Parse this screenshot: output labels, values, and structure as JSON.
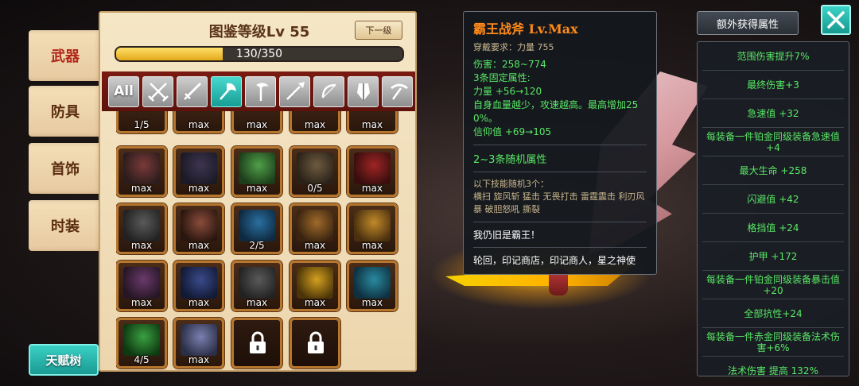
{
  "nav": {
    "tabs": [
      "武器",
      "防具",
      "首饰",
      "时装"
    ],
    "active_tab": "武器",
    "talent_button": "天赋树"
  },
  "panel": {
    "title": "图鉴等级Lv 55",
    "next_button": "下一级",
    "progress_text": "130/350",
    "progress_value": 130,
    "progress_max": 350
  },
  "filters": [
    {
      "label": "All",
      "icon": "all-text",
      "active": false
    },
    {
      "label": "",
      "icon": "crossed-swords-icon",
      "active": false
    },
    {
      "label": "",
      "icon": "sword-icon",
      "active": false
    },
    {
      "label": "",
      "icon": "axe-icon",
      "active": true
    },
    {
      "label": "",
      "icon": "scythe-icon",
      "active": false
    },
    {
      "label": "",
      "icon": "spear-icon",
      "active": false
    },
    {
      "label": "",
      "icon": "bow-icon",
      "active": false
    },
    {
      "label": "",
      "icon": "shield-icon",
      "active": false
    },
    {
      "label": "",
      "icon": "pickaxe-icon",
      "active": false
    }
  ],
  "partial_row": [
    "1/5",
    "max",
    "max",
    "max",
    "max"
  ],
  "items": [
    [
      "max",
      "max",
      "max",
      "0/5",
      "max"
    ],
    [
      "max",
      "max",
      "2/5",
      "max",
      "max"
    ],
    [
      "max",
      "max",
      "max",
      "max",
      "max"
    ],
    [
      "4/5",
      "max",
      "locked",
      "locked"
    ]
  ],
  "tooltip": {
    "title": "霸王战斧 Lv.Max",
    "requirement": "穿戴要求：力量 755",
    "damage": "伤害：258~774",
    "fixed_count": "3条固定属性:",
    "stat1": "力量 +56→120",
    "stat2": "自身血量越少，攻速越高。最高增加25 0%。",
    "stat3": "信仰值 +69→105",
    "random": "2~3条随机属性",
    "skills_head": "以下技能随机3个：",
    "skills": "横扫 旋风斩 猛击 无畏打击 雷霆震击 利刃风暴 破胆怒吼 撕裂",
    "quote": "我仍旧是霸王！",
    "source": "轮回，印记商店，印记商人，星之神使"
  },
  "extra": {
    "title": "额外获得属性",
    "rows": [
      "范围伤害提升7%",
      "最终伤害+3",
      "急速值 +32",
      "每装备一件铂金同级装备急速值+4",
      "最大生命 +258",
      "闪避值 +42",
      "格挡值 +24",
      "护甲 +172",
      "每装备一件铂金同级装备暴击值+20",
      "全部抗性+24",
      "每装备一件赤金同级装备法术伤害+6%",
      "法术伤害 提高 132%"
    ]
  },
  "colors": {
    "accent": "#1fb3a8",
    "panel_bg": "#f0dcb4",
    "filter_bar": "#6b1710",
    "green_text": "#59e866",
    "title_orange": "#ff8a1a"
  }
}
